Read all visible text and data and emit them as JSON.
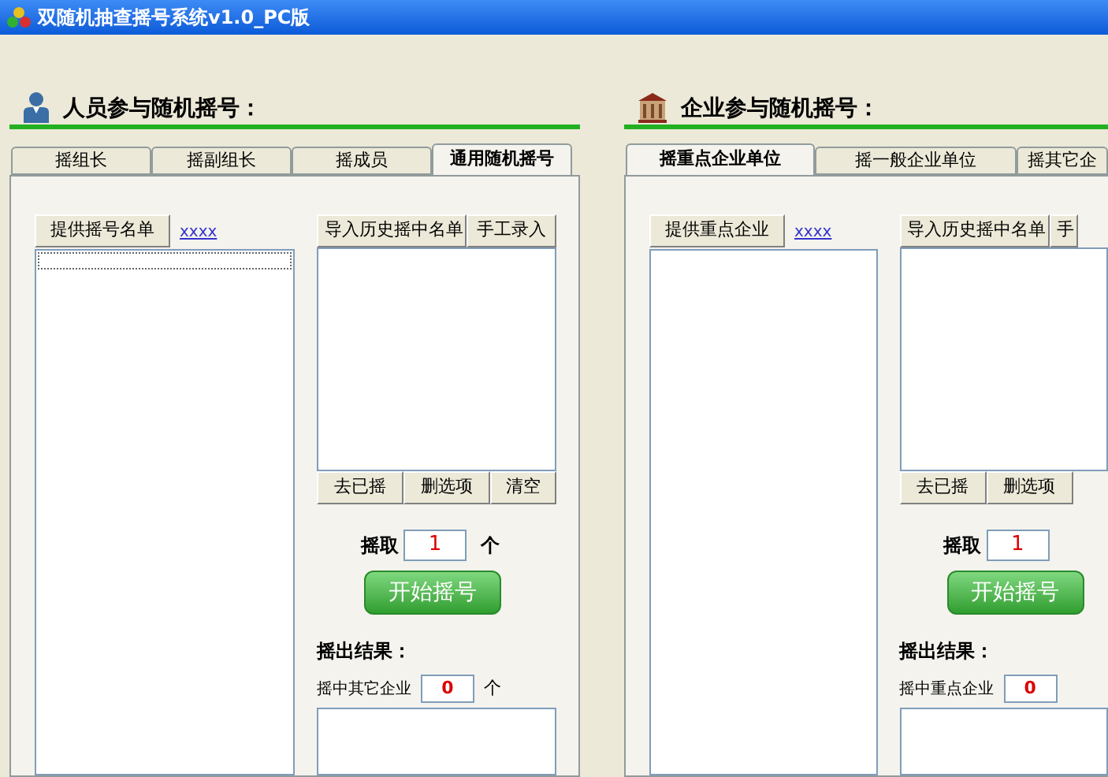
{
  "window": {
    "title": "双随机抽查摇号系统v1.0_PC版"
  },
  "panels": [
    {
      "kind": "person",
      "title": "人员参与随机摇号：",
      "tabs": [
        {
          "label": "摇组长",
          "selected": false
        },
        {
          "label": "摇副组长",
          "selected": false
        },
        {
          "label": "摇成员",
          "selected": false
        },
        {
          "label": "通用随机摇号",
          "selected": true
        }
      ],
      "list_button": "提供摇号名单",
      "link": "xxxx",
      "import_buttons": [
        "导入历史摇中名单",
        "手工录入"
      ],
      "action_buttons": [
        "去已摇",
        "删选项",
        "清空"
      ],
      "draw_label": "摇取",
      "draw_count": "1",
      "draw_unit": "个",
      "start_button": "开始摇号",
      "result_title": "摇出结果：",
      "result_label": "摇中其它企业",
      "result_count": "0",
      "result_unit": "个"
    },
    {
      "kind": "company",
      "title": "企业参与随机摇号：",
      "tabs": [
        {
          "label": "摇重点企业单位",
          "selected": true
        },
        {
          "label": "摇一般企业单位",
          "selected": false
        },
        {
          "label": "摇其它企",
          "selected": false
        }
      ],
      "list_button": "提供重点企业",
      "link": "xxxx",
      "import_buttons": [
        "导入历史摇中名单",
        "手"
      ],
      "action_buttons": [
        "去已摇",
        "删选项"
      ],
      "draw_label": "摇取",
      "draw_count": "1",
      "start_button": "开始摇号",
      "result_title": "摇出结果：",
      "result_label": "摇中重点企业",
      "result_count": "0"
    }
  ]
}
